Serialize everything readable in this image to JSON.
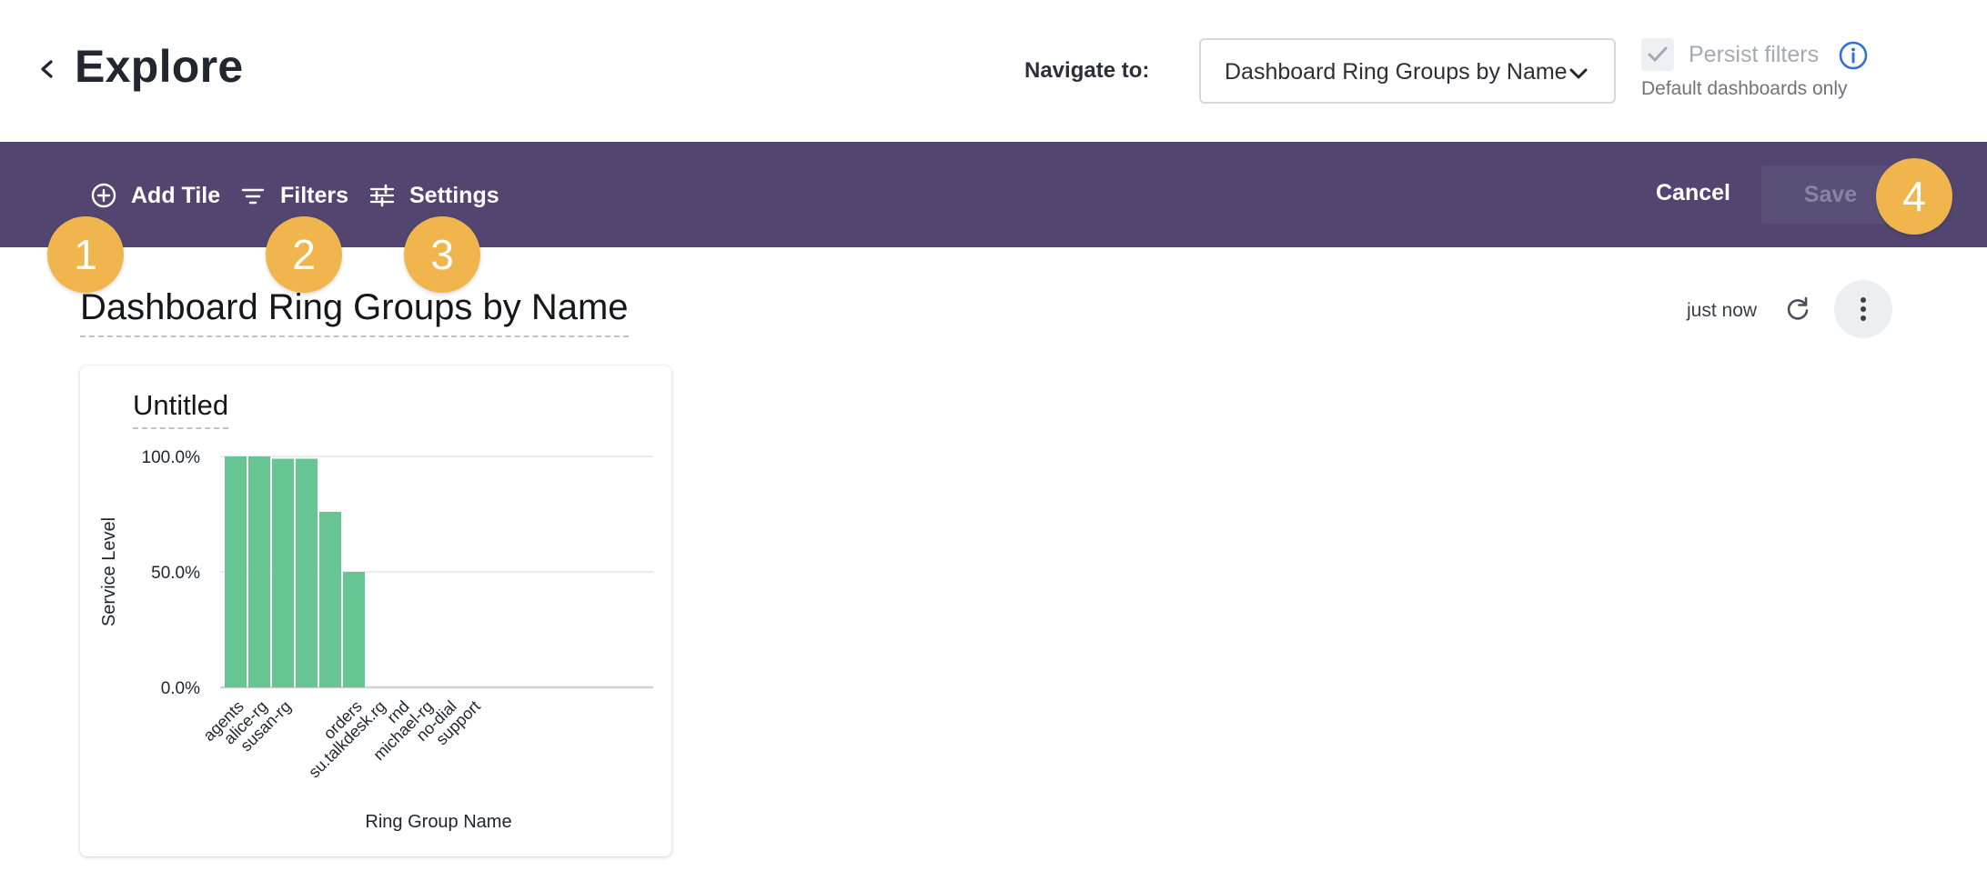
{
  "header": {
    "title": "Explore",
    "navigate_label": "Navigate to:",
    "navigate_value": "Dashboard Ring Groups by Name",
    "persist_label": "Persist filters",
    "persist_sub": "Default dashboards only",
    "persist_checked": true
  },
  "toolbar": {
    "add_tile": "Add Tile",
    "filters": "Filters",
    "settings": "Settings",
    "cancel": "Cancel",
    "save": "Save"
  },
  "badges": [
    "1",
    "2",
    "3",
    "4"
  ],
  "dashboard": {
    "title": "Dashboard Ring Groups by Name",
    "updated": "just now"
  },
  "tile": {
    "title": "Untitled"
  },
  "colors": {
    "toolbar_bg": "#524670",
    "badge": "#f0b64d",
    "bar": "#66c593",
    "info": "#2f6fe0"
  },
  "chart_data": {
    "type": "bar",
    "xlabel": "Ring Group Name",
    "ylabel": "Service Level",
    "ylim": [
      0,
      1
    ],
    "yticks": [
      {
        "value": 1.0,
        "label": "100.0%"
      },
      {
        "value": 0.5,
        "label": "50.0%"
      },
      {
        "value": 0.0,
        "label": "0.0%"
      }
    ],
    "categories": [
      "agents",
      "alice-rg",
      "susan-rg",
      "",
      "",
      "orders",
      "su.talkdesk.rg",
      "rnd",
      "michael-rg",
      "no-dial",
      "support"
    ],
    "values": [
      1.0,
      1.0,
      0.99,
      0.99,
      0.76,
      0.5,
      0,
      0,
      0,
      0,
      0
    ]
  }
}
